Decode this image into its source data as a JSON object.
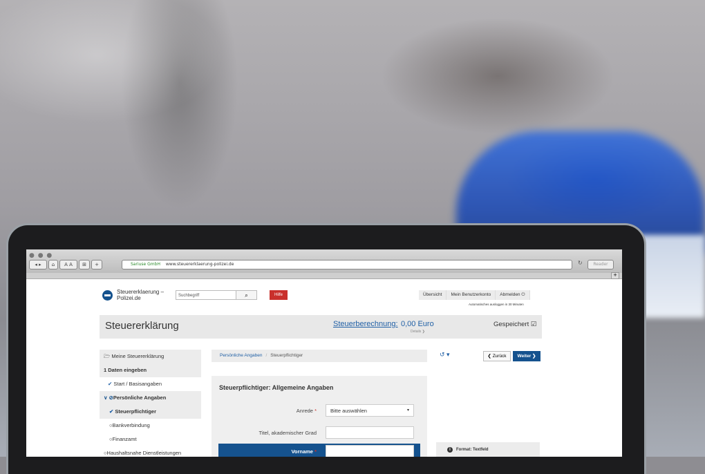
{
  "browser": {
    "company_cert": "Sariuse GmbH",
    "url": "www.steuererklaerung-polizei.de",
    "reader_label": "Reader"
  },
  "header": {
    "brand_line1": "Steuererklaerung –",
    "brand_line2": "Polizei.de",
    "search_placeholder": "Suchbegriff",
    "help_label": "Hilfe",
    "nav": [
      "Übersicht",
      "Mein Benutzerkonto",
      "Abmelden"
    ],
    "auto_logout": "Automatisches ausloggen in 30 Minuten"
  },
  "titlebar": {
    "title": "Steuererklärung",
    "calc_label": "Steuerberechnung:",
    "amount": "0,00 Euro",
    "details": "Details",
    "saved": "Gespeichert"
  },
  "sidebar": {
    "items": [
      {
        "label": "Meine Steuererklärung"
      },
      {
        "label": "1 Daten eingeben"
      },
      {
        "label": "Start / Basisangaben"
      },
      {
        "label": "Persönliche Angaben"
      },
      {
        "label": "Steuerpflichtiger"
      },
      {
        "label": "Bankverbindung"
      },
      {
        "label": "Finanzamt"
      },
      {
        "label": "Haushaltsnahe Dienstleistungen"
      }
    ]
  },
  "breadcrumb": {
    "parent": "Persönliche Angaben",
    "current": "Steuerpflichtiger"
  },
  "actions": {
    "back": "Zurück",
    "next": "Weiter"
  },
  "form": {
    "heading": "Steuerpflichtiger: Allgemeine Angaben",
    "anrede_label": "Anrede",
    "anrede_value": "Bitte auswählen",
    "titel_label": "Titel, akademischer Grad",
    "vorname_label": "Vorname",
    "required_mark": "*"
  },
  "hint": {
    "text": "Format: Textfeld"
  },
  "colors": {
    "primary": "#15528e",
    "link": "#1f5fa5",
    "help": "#c9302c"
  }
}
